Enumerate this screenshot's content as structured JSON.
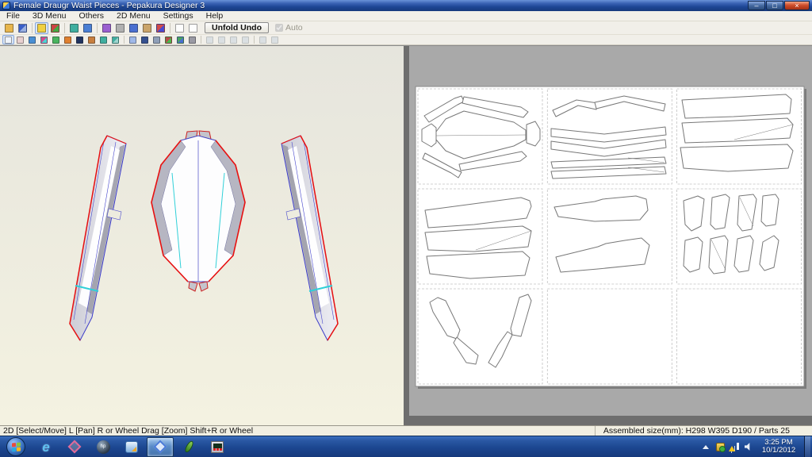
{
  "window": {
    "title": "Female Draugr Waist Pieces - Pepakura Designer 3",
    "controls": [
      {
        "name": "minimize-button",
        "glyph": "–"
      },
      {
        "name": "maximize-button",
        "glyph": "□"
      },
      {
        "name": "close-button",
        "glyph": "×"
      }
    ]
  },
  "menu_bar": {
    "items": [
      "File",
      "3D Menu",
      "Others",
      "2D Menu",
      "Settings",
      "Help"
    ]
  },
  "toolbars": {
    "main": {
      "unfold_button": "Unfold Undo",
      "auto_label": "Auto",
      "auto_checked": true,
      "icons": [
        {
          "name": "open-file-icon",
          "c": "#e8b64c"
        },
        {
          "name": "save-file-icon",
          "c": "#3a5fc8",
          "c2": "#9ab0e0"
        },
        {
          "sep": true
        },
        {
          "name": "texture-light-icon",
          "c": "#f0d040",
          "pressed": true
        },
        {
          "name": "material-sphere-icon",
          "c": "#cc4444",
          "c2": "#44aa44"
        },
        {
          "sep": true
        },
        {
          "name": "rotate-view-left-icon",
          "c": "#3fae9f"
        },
        {
          "name": "rotate-view-right-icon",
          "c": "#4a7fd4"
        },
        {
          "sep": true
        },
        {
          "name": "pen-edit-icon",
          "c": "#9a5fd0"
        },
        {
          "name": "pin-tool-icon",
          "c": "#b0b0b0"
        },
        {
          "name": "anchor-tool-icon",
          "c": "#4a6fd0"
        },
        {
          "name": "box-tool-icon",
          "c": "#caa46a"
        },
        {
          "name": "magnet-tool-icon",
          "c": "#d04a4a",
          "c2": "#4a4ad0"
        },
        {
          "sep": true
        },
        {
          "name": "layout-single-window-icon",
          "c": "#fdfdfd"
        },
        {
          "name": "layout-split-window-icon",
          "c": "#fdfdfd"
        }
      ]
    },
    "second": {
      "icons": [
        {
          "name": "select-move-icon",
          "c": "#eef3fb",
          "pressed": true
        },
        {
          "name": "select-lasso-icon",
          "c": "#e8d0d0"
        },
        {
          "name": "fit-screen-icon",
          "c": "#4a8fd4"
        },
        {
          "name": "color-swirl-icon",
          "c": "#d44a8f",
          "c2": "#4ad4d4"
        },
        {
          "name": "battery-icon",
          "c": "#4ab45f"
        },
        {
          "name": "text-box-icon",
          "c": "#e08030"
        },
        {
          "name": "dark-screen-icon",
          "c": "#20335f"
        },
        {
          "name": "flip-piece-icon",
          "c": "#c87f3f"
        },
        {
          "name": "undo-icon",
          "c": "#3fae9f"
        },
        {
          "name": "redo-icon",
          "c": "#3fae9f",
          "c2": "#9fd4ce"
        },
        {
          "sep": true
        },
        {
          "name": "marquee-zoom-icon",
          "c": "#9fb8e8"
        },
        {
          "name": "binoculars-icon",
          "c": "#35508f"
        },
        {
          "name": "part-info-icon",
          "c": "#8f9fb8"
        },
        {
          "name": "paint-parts-icon",
          "c": "#b84a4a",
          "c2": "#4ab84a"
        },
        {
          "name": "image-export-icon",
          "c": "#4aa45f",
          "c2": "#4a6fd0"
        },
        {
          "name": "print-icon",
          "c": "#9a9aa4"
        },
        {
          "sep": true
        },
        {
          "name": "align-left-icon",
          "c": "#b8c8d8",
          "disabled": true
        },
        {
          "name": "align-top-icon",
          "c": "#b8c8d8",
          "disabled": true
        },
        {
          "name": "align-right-icon",
          "c": "#b8c8d8",
          "disabled": true
        },
        {
          "name": "align-bottom-icon",
          "c": "#b8c8d8",
          "disabled": true
        },
        {
          "sep": true
        },
        {
          "name": "rotate-part-ccw-icon",
          "c": "#b8c8d8",
          "disabled": true
        },
        {
          "name": "rotate-part-cw-icon",
          "c": "#b8c8d8",
          "disabled": true
        }
      ]
    }
  },
  "status_bar": {
    "left": "2D [Select/Move] L [Pan] R or Wheel Drag [Zoom] Shift+R or Wheel",
    "right": "Assembled size(mm): H298 W395 D190 / Parts 25"
  },
  "taskbar": {
    "items": [
      {
        "name": "start-button",
        "active": false
      },
      {
        "name": "internet-explorer-icon",
        "active": false
      },
      {
        "name": "pepakura-viewer-icon",
        "active": false
      },
      {
        "name": "hp-globe-icon",
        "active": false
      },
      {
        "name": "photo-viewer-icon",
        "active": false
      },
      {
        "name": "pepakura-designer-icon",
        "active": true
      },
      {
        "name": "fern-plant-icon",
        "active": false
      },
      {
        "name": "instrument-device-icon",
        "active": false
      }
    ],
    "tray": {
      "icons": [
        {
          "name": "show-hidden-icons-arrow"
        },
        {
          "name": "security-shield-icon"
        },
        {
          "name": "network-warning-icon"
        },
        {
          "name": "volume-icon"
        }
      ],
      "time": "3:25 PM",
      "date": "10/1/2012"
    }
  },
  "colors": {
    "titlebar_blue": "#1e4796",
    "taskbar_blue": "#1c4690",
    "pane3d_bg_top": "#e6e5dd",
    "pane3d_bg_bottom": "#f4f2e1",
    "pane2d_bg": "#a9a9a9",
    "open_edge_red": "#e81010",
    "fold_edge_blue": "#4040c0",
    "fold_edge_cyan": "#30d0d8",
    "page_white": "#ffffff"
  }
}
